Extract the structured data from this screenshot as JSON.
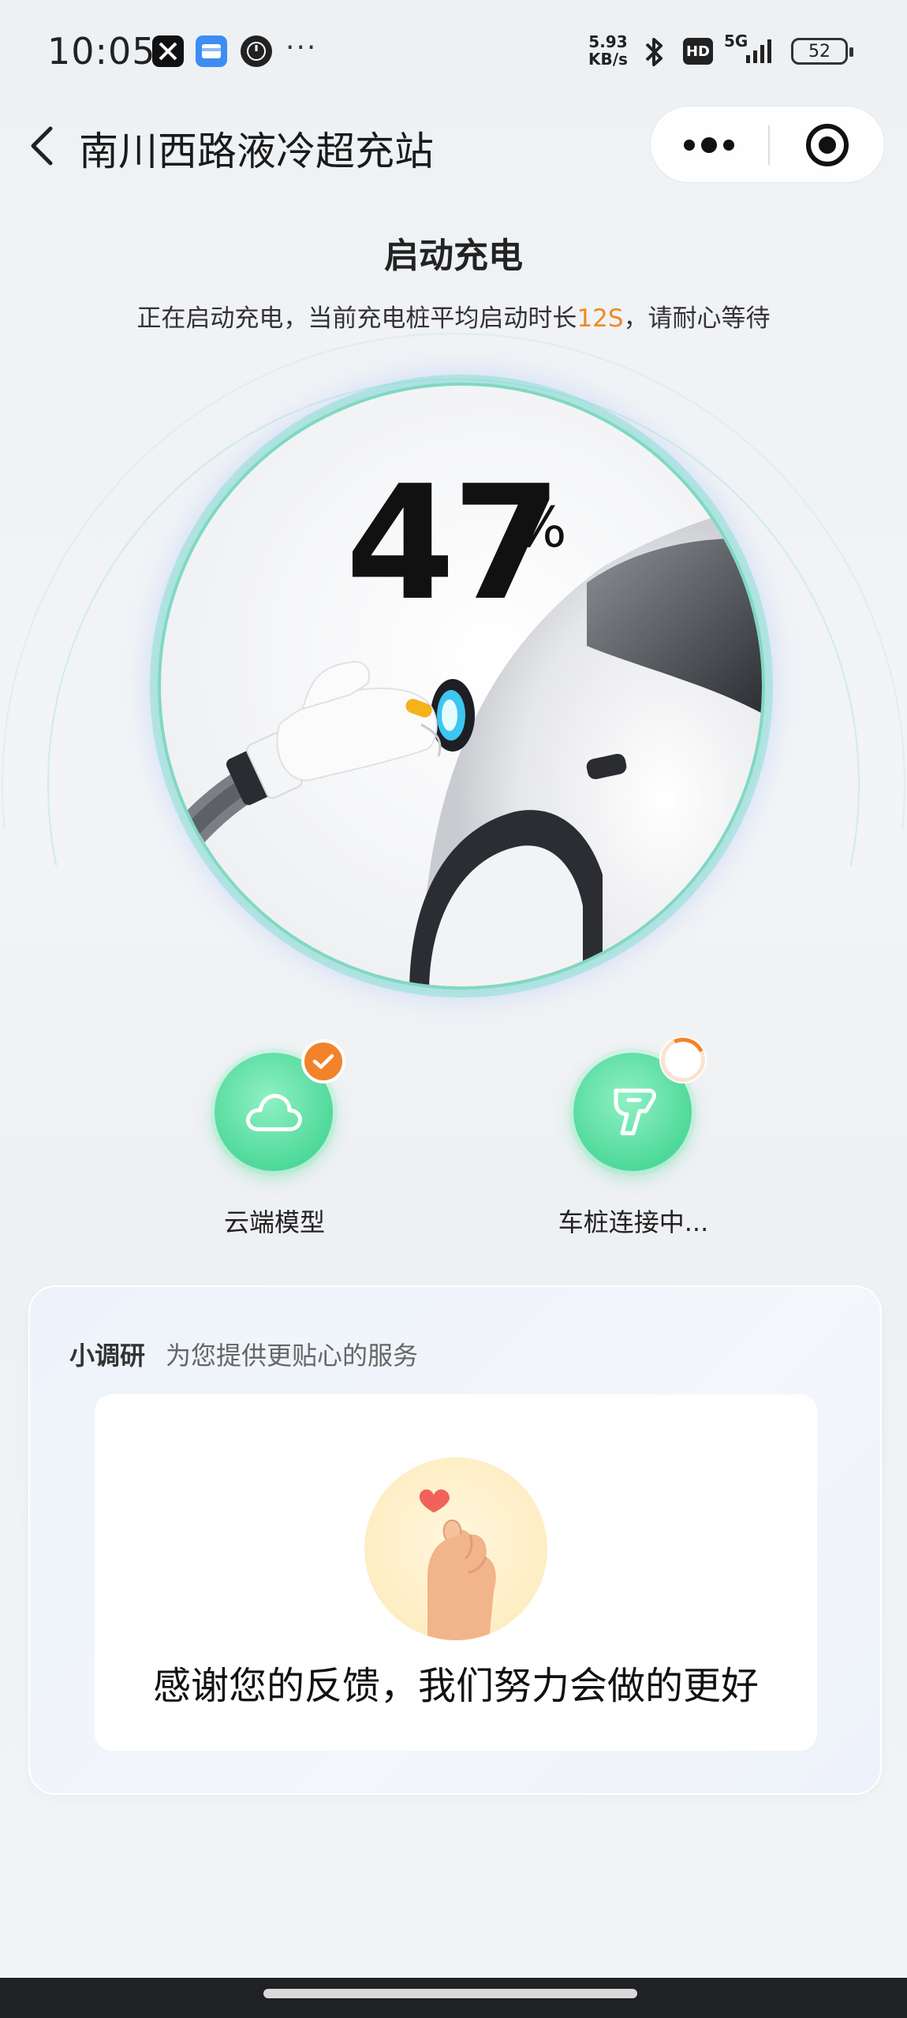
{
  "status_bar": {
    "time": "10:05",
    "dots": "···",
    "net_speed_value": "5.93",
    "net_speed_unit": "KB/s",
    "hd": "HD",
    "network": "5G",
    "battery": "52",
    "icons": [
      "x-app-icon",
      "wallet-app-icon",
      "clock-app-icon",
      "bluetooth-icon",
      "hd-icon",
      "signal-icon",
      "battery-icon"
    ]
  },
  "nav": {
    "title": "南川西路液冷超充站",
    "back_icon": "chevron-left-icon",
    "more_icon": "more-dots-icon",
    "close_icon": "target-close-icon"
  },
  "charging": {
    "heading": "启动充电",
    "subtitle_prefix": "正在启动充电，当前充电桩平均启动时长",
    "subtitle_highlight": "12S",
    "subtitle_suffix": "，请耐心等待",
    "percent_value": "47",
    "percent_sign": "%",
    "progress": 47
  },
  "steps": [
    {
      "label": "云端模型",
      "icon": "cloud-icon",
      "status": "done"
    },
    {
      "label": "车桩连接中...",
      "icon": "charger-plug-icon",
      "status": "loading"
    }
  ],
  "survey": {
    "title": "小调研",
    "subtitle": "为您提供更贴心的服务",
    "thanks": "感谢您的反馈，我们努力会做的更好",
    "image_icon": "finger-heart-icon"
  },
  "colors": {
    "accent_orange": "#f08a24",
    "step_green": "#4fd99a",
    "ring_teal": "#7fd9c0"
  }
}
